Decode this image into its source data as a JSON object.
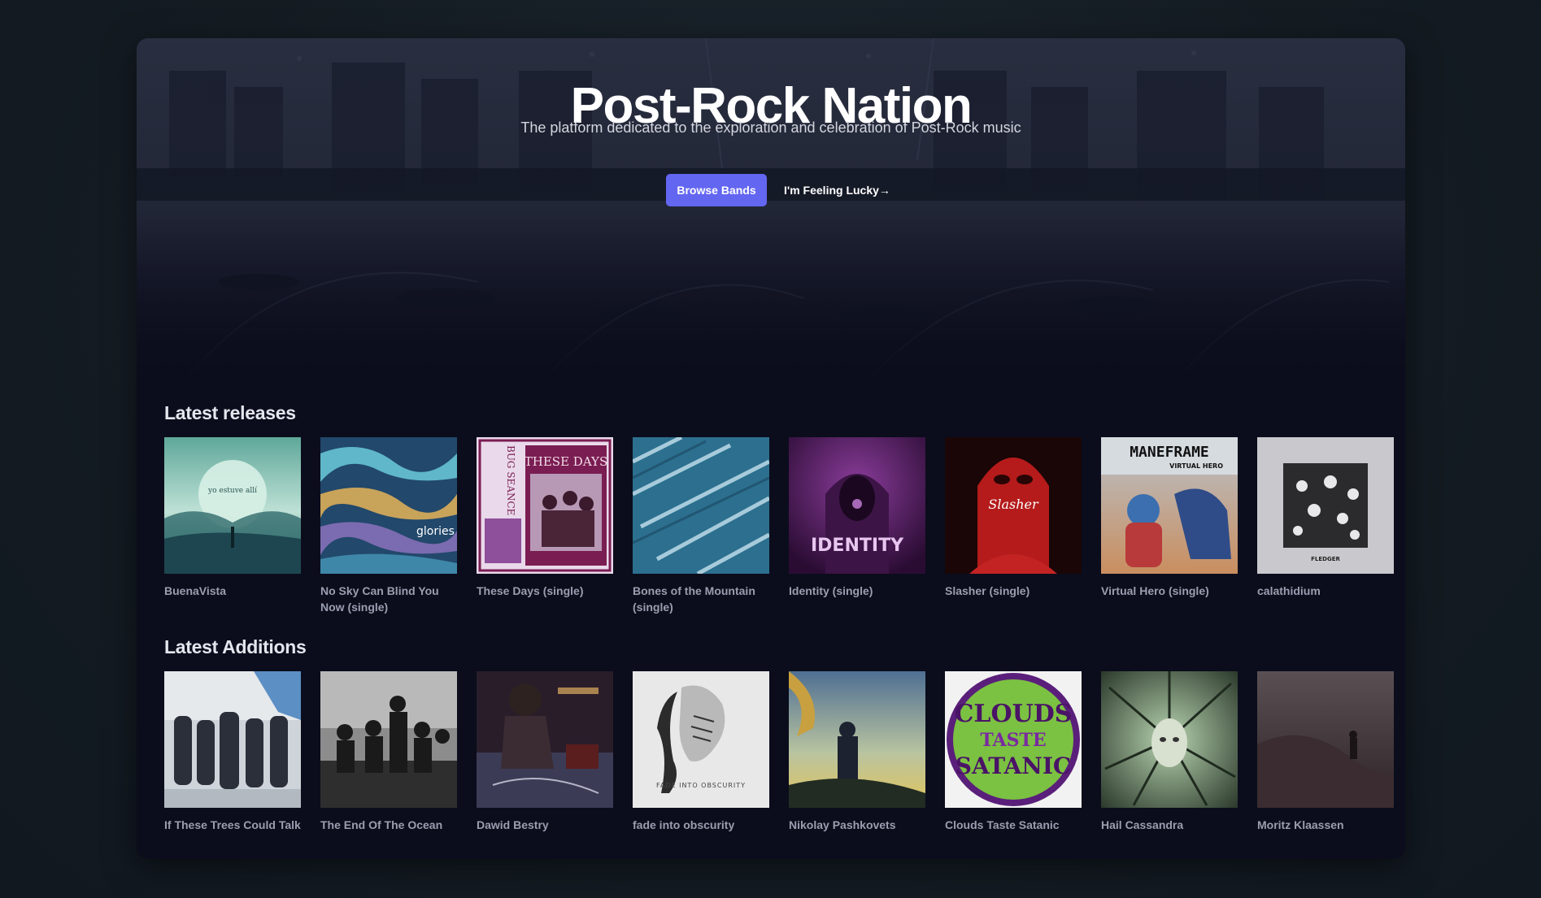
{
  "hero": {
    "title": "Post-Rock Nation",
    "subtitle": "The platform dedicated to the exploration and celebration of Post-Rock music",
    "browse_label": "Browse Bands",
    "lucky_label": "I'm Feeling Lucky→"
  },
  "releases": {
    "heading": "Latest releases",
    "items": [
      {
        "title": "BuenaVista",
        "cover_text": "yo estuve allí"
      },
      {
        "title": "No Sky Can Blind You Now (single)",
        "cover_text": "glories"
      },
      {
        "title": "These Days (single)",
        "cover_text": "THESE DAYS",
        "cover_text2": "BUG SEANCE"
      },
      {
        "title": "Bones of the Mountain (single)"
      },
      {
        "title": "Identity (single)",
        "cover_text": "IDENTITY"
      },
      {
        "title": "Slasher (single)",
        "cover_text": "Slasher"
      },
      {
        "title": "Virtual Hero (single)",
        "cover_text": "MANEFRAME",
        "cover_text2": "VIRTUAL HERO"
      },
      {
        "title": "calathidium",
        "cover_text": "FLEDGER"
      }
    ]
  },
  "additions": {
    "heading": "Latest Additions",
    "items": [
      {
        "title": "If These Trees Could Talk"
      },
      {
        "title": "The End Of The Ocean"
      },
      {
        "title": "Dawid Bestry"
      },
      {
        "title": "fade into obscurity",
        "cover_text": "FADE INTO OBSCURITY"
      },
      {
        "title": "Nikolay Pashkovets"
      },
      {
        "title": "Clouds Taste Satanic",
        "cover_text": "CLOUDS",
        "cover_text2": "TASTE",
        "cover_text3": "SATANIC"
      },
      {
        "title": "Hail Cassandra"
      },
      {
        "title": "Moritz Klaassen"
      }
    ]
  },
  "colors": {
    "accent": "#6366f1",
    "page_bg": "#141c22",
    "card_bg": "#0b0d1c",
    "muted_text": "#9b9eb0"
  }
}
